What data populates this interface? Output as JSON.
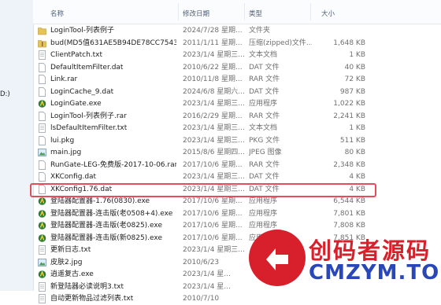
{
  "nav": {
    "drive_label": "D:)"
  },
  "columns": {
    "name": "名称",
    "date": "修改日期",
    "type": "类型",
    "size": "大小"
  },
  "files": [
    {
      "name": "LoginTool-列表例子",
      "date": "2024/7/28 星期...",
      "type": "文件夹",
      "size": "",
      "icon": "folder"
    },
    {
      "name": "bud(MD5值631AE5B94DE78CC7543F...",
      "date": "2011/1/11 星期...",
      "type": "压缩(zipped)文件...",
      "size": "1,648 KB",
      "icon": "zip"
    },
    {
      "name": "ClientPatch.txt",
      "date": "2023/1/4 星期三...",
      "type": "文本文档",
      "size": "1 KB",
      "icon": "text"
    },
    {
      "name": "DefaultItemFilter.dat",
      "date": "2010/6/22 星期...",
      "type": "DAT 文件",
      "size": "40 KB",
      "icon": "file"
    },
    {
      "name": "Link.rar",
      "date": "2010/11/8 星期...",
      "type": "RAR 文件",
      "size": "72 KB",
      "icon": "file"
    },
    {
      "name": "LoginCache_9.dat",
      "date": "2024/6/8 星期六...",
      "type": "DAT 文件",
      "size": "987 KB",
      "icon": "file"
    },
    {
      "name": "LoginGate.exe",
      "date": "2023/1/4 星期三...",
      "type": "应用程序",
      "size": "1,022 KB",
      "icon": "exe"
    },
    {
      "name": "LoginTool-列表例子.rar",
      "date": "2016/2/29 星期...",
      "type": "RAR 文件",
      "size": "2,241 KB",
      "icon": "file"
    },
    {
      "name": "lsDefaultItemFilter.txt",
      "date": "2023/1/4 星期三...",
      "type": "文本文档",
      "size": "1 KB",
      "icon": "text"
    },
    {
      "name": "lui.pkg",
      "date": "2023/1/4 星期三...",
      "type": "PKG 文件",
      "size": "511 KB",
      "icon": "file"
    },
    {
      "name": "main.jpg",
      "date": "2015/8/6 星期四...",
      "type": "JPEG 图像",
      "size": "80 KB",
      "icon": "image"
    },
    {
      "name": "RunGate-LEG-免费版-2017-10-06.rar",
      "date": "2017/10/6 星期...",
      "type": "RAR 文件",
      "size": "2,348 KB",
      "icon": "file"
    },
    {
      "name": "XKConfig.dat",
      "date": "2023/1/4 星期三...",
      "type": "DAT 文件",
      "size": "4 KB",
      "icon": "file"
    },
    {
      "name": "XKConfig1.76.dat",
      "date": "2023/1/4 星期三...",
      "type": "DAT 文件",
      "size": "4 KB",
      "icon": "file"
    },
    {
      "name": "登陆器配置器-1.76(0830).exe",
      "date": "2017/10/6 星期...",
      "type": "应用程序",
      "size": "6,544 KB",
      "icon": "exe"
    },
    {
      "name": "登陆器配置器-连击版(老0508+4).exe",
      "date": "2017/10/6 星期...",
      "type": "应用程序",
      "size": "7,801 KB",
      "icon": "exe"
    },
    {
      "name": "登陆器配置器-连击版(老0825).exe",
      "date": "2017/10/6 星期...",
      "type": "应用程序",
      "size": "7,808 KB",
      "icon": "exe"
    },
    {
      "name": "登陆器配置器-连击版(新0825).exe",
      "date": "2017/10/6 星期...",
      "type": "应用程序",
      "size": "7,851 KB",
      "icon": "exe"
    },
    {
      "name": "更新日志.txt",
      "date": "2023/1/4 星期三...",
      "type": "",
      "size": "",
      "icon": "text"
    },
    {
      "name": "皮肤2.jpg",
      "date": "2010/6/23",
      "type": "",
      "size": "",
      "icon": "image"
    },
    {
      "name": "逍遥复古.exe",
      "date": "2023/1/4 星...",
      "type": "",
      "size": "",
      "icon": "exe"
    },
    {
      "name": "新登陆器必读说明3.txt",
      "date": "2023/1/4 星...",
      "type": "",
      "size": "",
      "icon": "text"
    },
    {
      "name": "自动更新物品过滤列表.txt",
      "date": "2010/7/10",
      "type": "",
      "size": "",
      "icon": "text"
    }
  ],
  "watermark": {
    "chinese": "创码者源码",
    "latin": "CMZYM.TOP"
  },
  "colors": {
    "highlight": "#e0505a",
    "folder": "#e6c25a",
    "watermark_red": "#d7202b",
    "watermark_blue": "#2a47b8"
  }
}
